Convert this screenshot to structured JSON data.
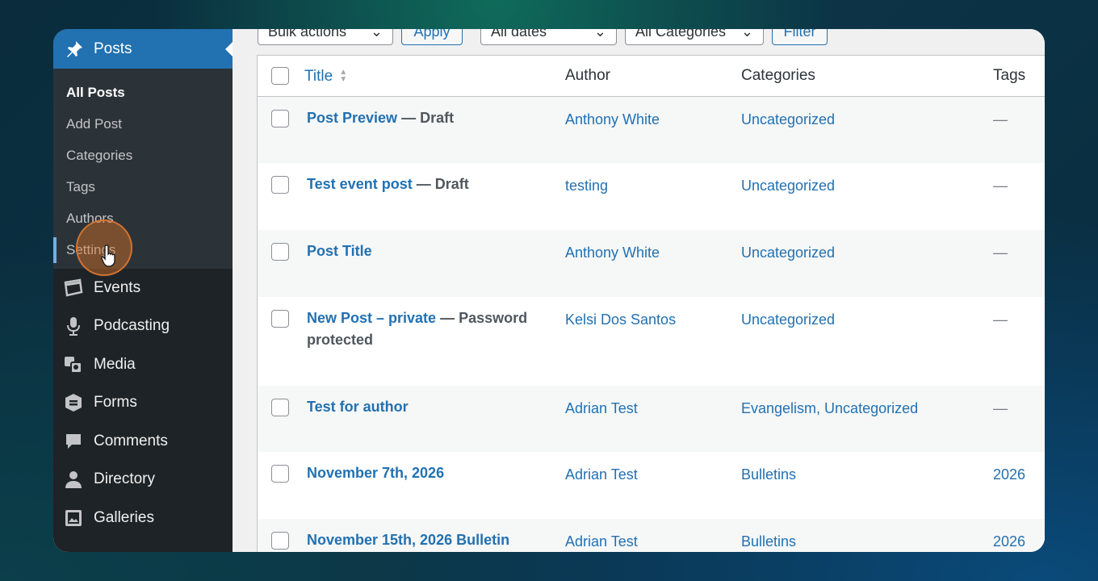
{
  "sidebar": {
    "header": {
      "label": "Posts",
      "icon": "pin-icon"
    },
    "submenu": [
      {
        "label": "All Posts"
      },
      {
        "label": "Add Post"
      },
      {
        "label": "Categories"
      },
      {
        "label": "Tags"
      },
      {
        "label": "Authors"
      },
      {
        "label": "Settings"
      }
    ],
    "items": [
      {
        "label": "Events",
        "icon": "calendar-icon"
      },
      {
        "label": "Podcasting",
        "icon": "microphone-icon"
      },
      {
        "label": "Media",
        "icon": "media-icon"
      },
      {
        "label": "Forms",
        "icon": "forms-icon"
      },
      {
        "label": "Comments",
        "icon": "comment-icon"
      },
      {
        "label": "Directory",
        "icon": "user-icon"
      },
      {
        "label": "Galleries",
        "icon": "gallery-icon"
      }
    ]
  },
  "toolbar": {
    "bulk_actions": "Bulk actions",
    "apply": "Apply",
    "dates": "All dates",
    "categories": "All Categories",
    "filter": "Filter"
  },
  "table": {
    "headers": {
      "title": "Title",
      "author": "Author",
      "categories": "Categories",
      "tags": "Tags"
    },
    "rows": [
      {
        "title": "Post Preview",
        "state": " — Draft",
        "author": "Anthony White",
        "categories": "Uncategorized",
        "tags": "—"
      },
      {
        "title": "Test event post",
        "state": " — Draft",
        "author": "testing",
        "categories": "Uncategorized",
        "tags": "—"
      },
      {
        "title": "Post Title",
        "state": "",
        "author": "Anthony White",
        "categories": "Uncategorized",
        "tags": "—"
      },
      {
        "title": "New Post – private",
        "state": " — Password protected",
        "author": "Kelsi Dos Santos",
        "categories": "Uncategorized",
        "tags": "—"
      },
      {
        "title": "Test for author",
        "state": "",
        "author": "Adrian Test",
        "categories": "Evangelism, Uncategorized",
        "tags": "—"
      },
      {
        "title": "November 7th, 2026",
        "state": "",
        "author": "Adrian Test",
        "categories": "Bulletins",
        "tags": "2026"
      },
      {
        "title": "November 15th, 2026 Bulletin",
        "state": "",
        "author": "Adrian Test",
        "categories": "Bulletins",
        "tags": "2026"
      }
    ]
  },
  "colors": {
    "accent": "#2271b1",
    "sidebar": "#1d2327",
    "submenu": "#2c3338"
  }
}
